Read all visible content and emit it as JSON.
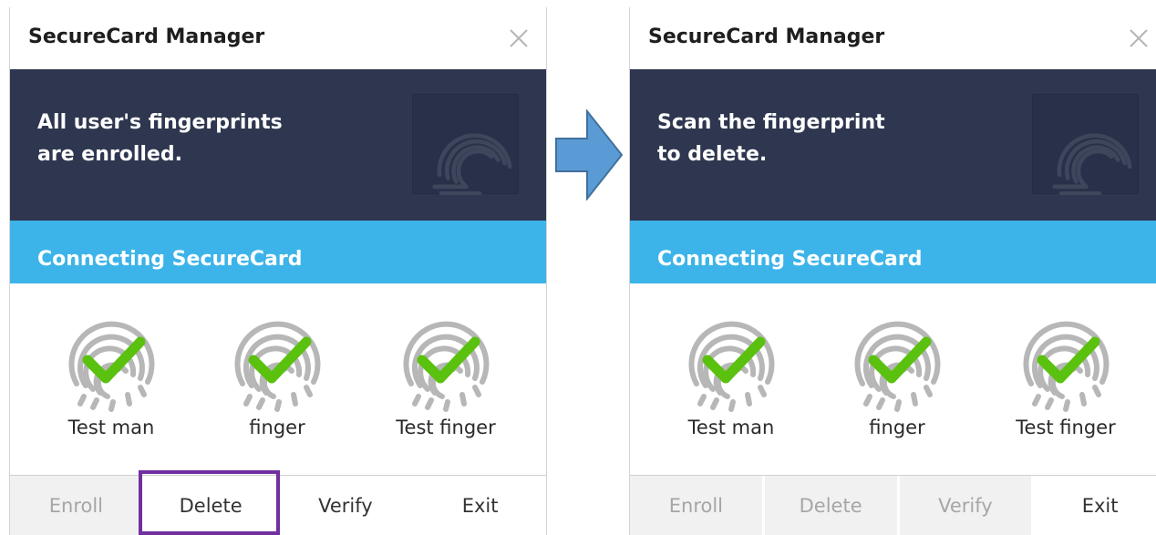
{
  "app_title": "SecureCard Manager",
  "status_text": "Connecting SecureCard",
  "users": [
    {
      "name": "Test man"
    },
    {
      "name": "finger"
    },
    {
      "name": "Test finger"
    }
  ],
  "buttons": {
    "enroll": "Enroll",
    "delete": "Delete",
    "verify": "Verify",
    "exit": "Exit"
  },
  "left_window": {
    "message_line1": "All user's fingerprints",
    "message_line2": "are enrolled."
  },
  "right_window": {
    "message_line1": "Scan the fingerprint",
    "message_line2": "to delete."
  },
  "colors": {
    "banner": "#2e374f",
    "status_bar": "#3cb4e9",
    "checkmark": "#5ac10f",
    "highlight": "#7030a0",
    "arrow": "#5b9bd5"
  },
  "icons": {
    "close": "close-icon",
    "fingerprint": "fingerprint-icon",
    "check": "checkmark-icon",
    "arrow": "arrow-right-icon"
  }
}
